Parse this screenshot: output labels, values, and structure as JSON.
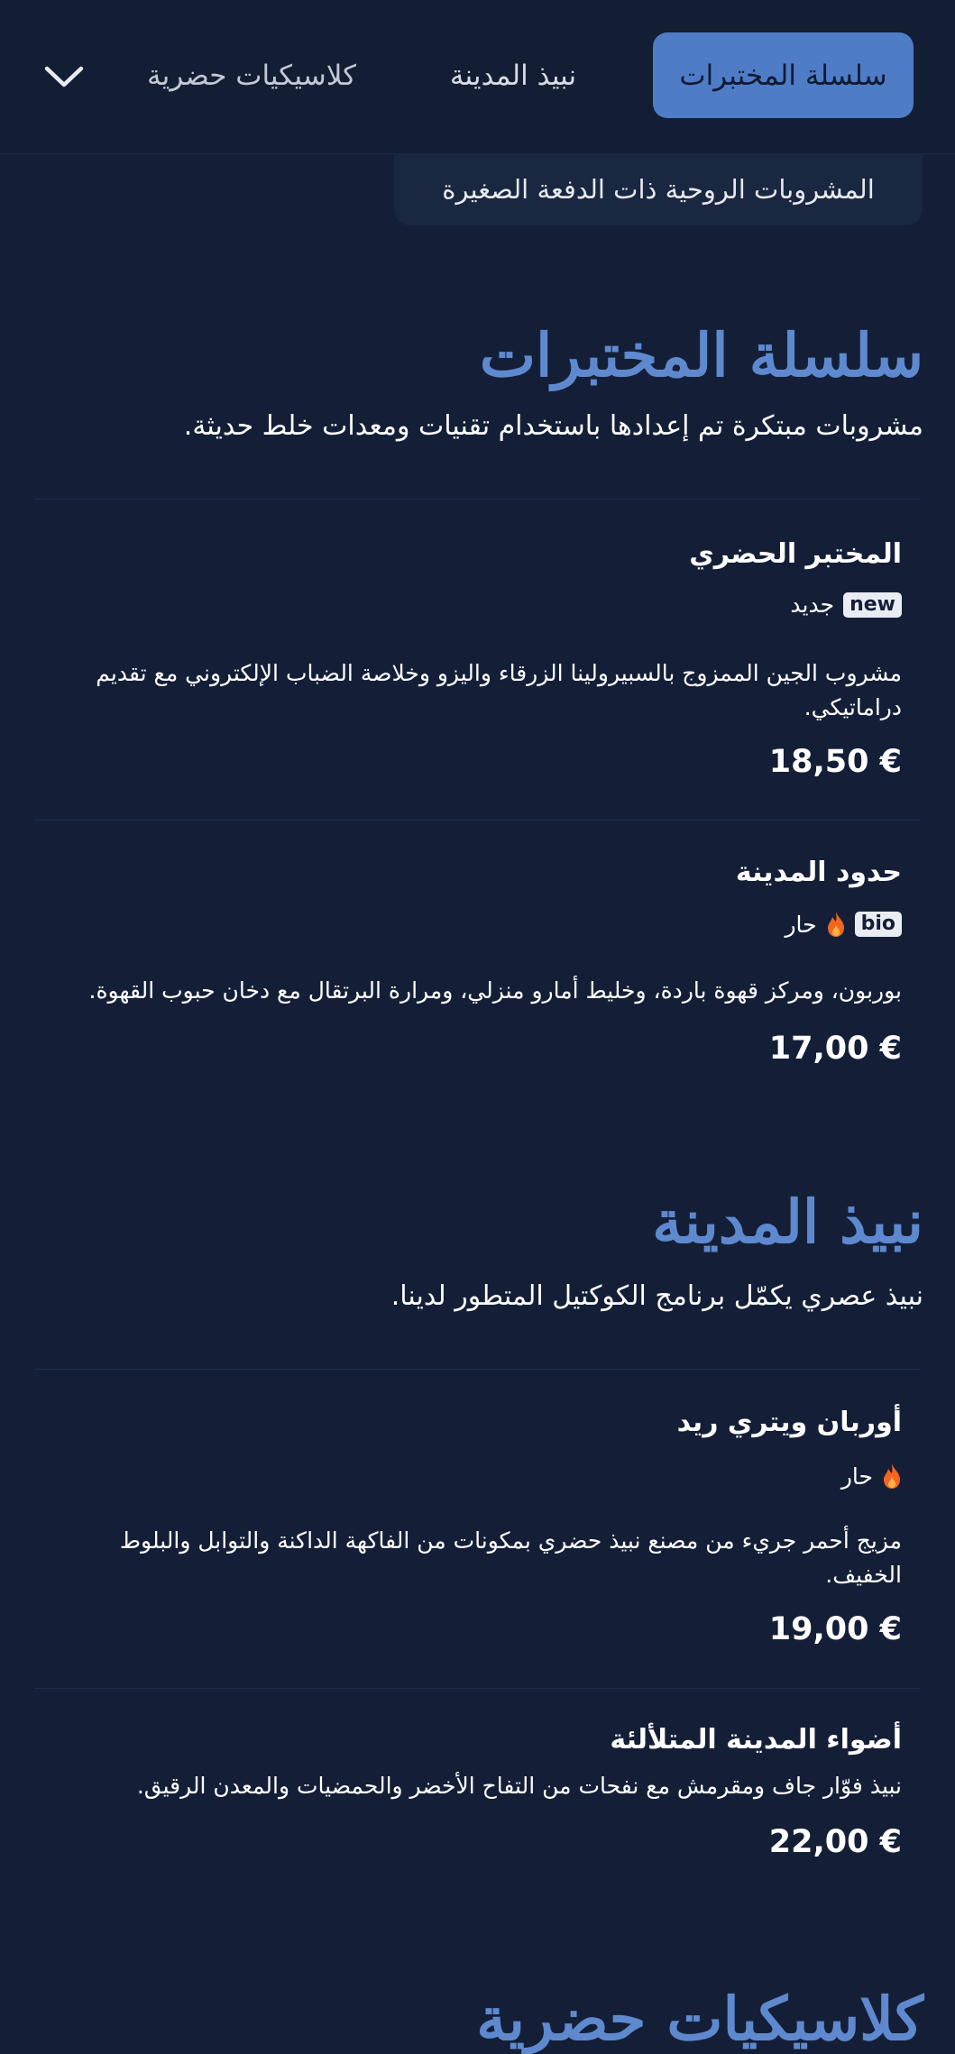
{
  "nav": {
    "tabs": [
      {
        "label": "سلسلة المختبرات",
        "active": true
      },
      {
        "label": "نبيذ المدينة",
        "active": false
      },
      {
        "label": "كلاسيكيات حضرية",
        "active": false
      }
    ],
    "expand_icon": "chevron-down-icon",
    "subcategory": "المشروبات الروحية ذات الدفعة الصغيرة"
  },
  "colors": {
    "background": "#141f37",
    "accent": "#5e89cf",
    "active_tab": "#4f7cc6",
    "flame": "#f26522"
  },
  "sections": [
    {
      "title": "سلسلة المختبرات",
      "description": "مشروبات مبتكرة تم إعدادها باستخدام تقنيات ومعدات خلط حديثة.",
      "items": [
        {
          "name": "المختبر الحضري",
          "badge": "new",
          "tag": "جديد",
          "description": "مشروب الجين الممزوج بالسبيرولينا الزرقاء واليزو وخلاصة الضباب الإلكتروني مع تقديم دراماتيكي.",
          "price": "18,50 €"
        },
        {
          "name": "حدود المدينة",
          "badge": "bio",
          "tag": "حار",
          "tag_icon": "flame-icon",
          "description": "بوربون، ومركز قهوة باردة، وخليط أمارو منزلي، ومرارة البرتقال مع دخان حبوب القهوة.",
          "price": "17,00 €"
        }
      ]
    },
    {
      "title": "نبيذ المدينة",
      "description": "نبيذ عصري يكمّل برنامج الكوكتيل المتطور لدينا.",
      "items": [
        {
          "name": "أوربان ويتري ريد",
          "tag": "حار",
          "tag_icon": "flame-icon",
          "description": "مزيج أحمر جريء من مصنع نبيذ حضري بمكونات من الفاكهة الداكنة والتوابل والبلوط الخفيف.",
          "price": "19,00 €"
        },
        {
          "name": "أضواء المدينة المتلألئة",
          "description": "نبيذ فوّار جاف ومقرمش مع نفحات من التفاح الأخضر والحمضيات والمعدن الرقيق.",
          "price": "22,00 €"
        }
      ]
    },
    {
      "title": "كلاسيكيات حضرية"
    }
  ]
}
